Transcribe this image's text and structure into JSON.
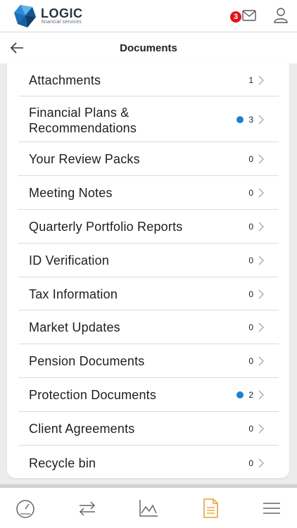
{
  "header": {
    "brand_name": "LOGIC",
    "brand_sub": "financial services",
    "mail_badge_count": "3"
  },
  "subheader": {
    "title": "Documents"
  },
  "documents": [
    {
      "label": "Attachments",
      "count": "1",
      "dot": false
    },
    {
      "label": "Financial Plans & Recommendations",
      "count": "3",
      "dot": true
    },
    {
      "label": "Your Review Packs",
      "count": "0",
      "dot": false
    },
    {
      "label": "Meeting Notes",
      "count": "0",
      "dot": false
    },
    {
      "label": "Quarterly Portfolio Reports",
      "count": "0",
      "dot": false
    },
    {
      "label": "ID Verification",
      "count": "0",
      "dot": false
    },
    {
      "label": "Tax Information",
      "count": "0",
      "dot": false
    },
    {
      "label": "Market Updates",
      "count": "0",
      "dot": false
    },
    {
      "label": "Pension Documents",
      "count": "0",
      "dot": false
    },
    {
      "label": "Protection Documents",
      "count": "2",
      "dot": true
    },
    {
      "label": "Client Agreements",
      "count": "0",
      "dot": false
    },
    {
      "label": "Recycle bin",
      "count": "0",
      "dot": false
    }
  ],
  "bottom_nav": [
    {
      "icon": "dashboard-gauge-icon",
      "active": false
    },
    {
      "icon": "transfer-arrows-icon",
      "active": false
    },
    {
      "icon": "chart-icon",
      "active": false
    },
    {
      "icon": "document-icon",
      "active": true
    },
    {
      "icon": "menu-icon",
      "active": false
    }
  ],
  "colors": {
    "accent_active": "#e8a13a",
    "unread_dot": "#1c7fd0",
    "badge": "#e0141e",
    "logo_blue": "#1f6fb8"
  }
}
